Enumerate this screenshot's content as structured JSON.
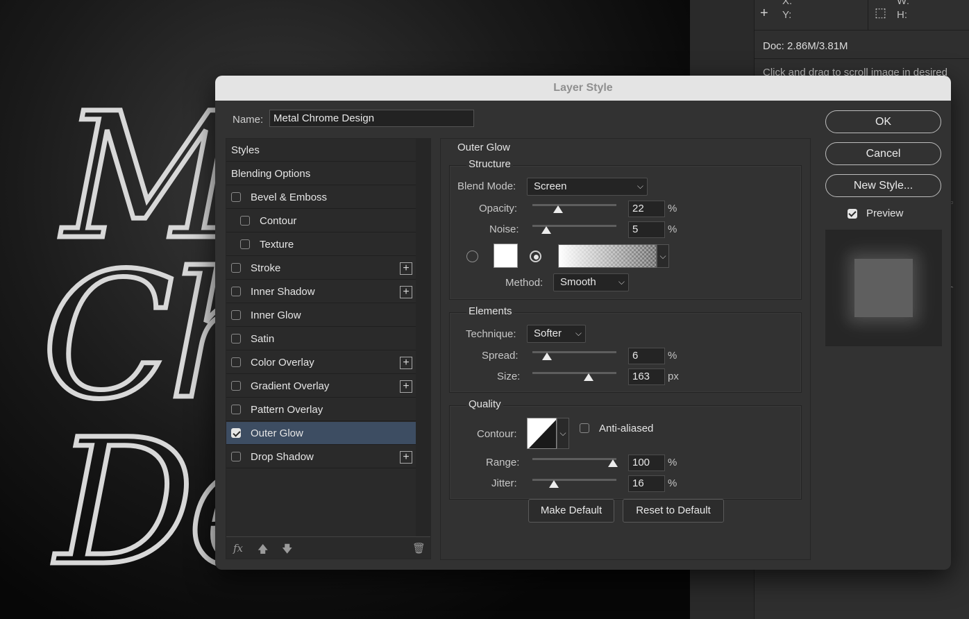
{
  "window": {
    "title": "Layer Style"
  },
  "info_panel": {
    "x_label": "X:",
    "y_label": "Y:",
    "w_label": "W:",
    "h_label": "H:",
    "doc_info": "Doc: 2.86M/3.81M",
    "hint": "Click and drag to scroll image in desired"
  },
  "canvas": {
    "lines": [
      "M",
      "Ch",
      "De"
    ]
  },
  "dialog": {
    "name_label": "Name:",
    "name_value": "Metal  Chrome Design",
    "styles_list": [
      {
        "label": "Styles",
        "checkbox": false,
        "checked": false,
        "plus": false,
        "selected": false,
        "indent": 0
      },
      {
        "label": "Blending Options",
        "checkbox": false,
        "checked": false,
        "plus": false,
        "selected": false,
        "indent": 0
      },
      {
        "label": "Bevel & Emboss",
        "checkbox": true,
        "checked": false,
        "plus": false,
        "selected": false,
        "indent": 0
      },
      {
        "label": "Contour",
        "checkbox": true,
        "checked": false,
        "plus": false,
        "selected": false,
        "indent": 1
      },
      {
        "label": "Texture",
        "checkbox": true,
        "checked": false,
        "plus": false,
        "selected": false,
        "indent": 1
      },
      {
        "label": "Stroke",
        "checkbox": true,
        "checked": false,
        "plus": true,
        "selected": false,
        "indent": 0
      },
      {
        "label": "Inner Shadow",
        "checkbox": true,
        "checked": false,
        "plus": true,
        "selected": false,
        "indent": 0
      },
      {
        "label": "Inner Glow",
        "checkbox": true,
        "checked": false,
        "plus": false,
        "selected": false,
        "indent": 0
      },
      {
        "label": "Satin",
        "checkbox": true,
        "checked": false,
        "plus": false,
        "selected": false,
        "indent": 0
      },
      {
        "label": "Color Overlay",
        "checkbox": true,
        "checked": false,
        "plus": true,
        "selected": false,
        "indent": 0
      },
      {
        "label": "Gradient Overlay",
        "checkbox": true,
        "checked": false,
        "plus": true,
        "selected": false,
        "indent": 0
      },
      {
        "label": "Pattern Overlay",
        "checkbox": true,
        "checked": false,
        "plus": false,
        "selected": false,
        "indent": 0
      },
      {
        "label": "Outer Glow",
        "checkbox": true,
        "checked": true,
        "plus": false,
        "selected": true,
        "indent": 0
      },
      {
        "label": "Drop Shadow",
        "checkbox": true,
        "checked": false,
        "plus": true,
        "selected": false,
        "indent": 0
      }
    ],
    "list_tools": {
      "fx": "fx",
      "up": "🡅",
      "down": "🡇",
      "trash": "🗑"
    },
    "outer_glow": {
      "section_title": "Outer Glow",
      "structure": {
        "title": "Structure",
        "blend_mode_label": "Blend Mode:",
        "blend_mode": "Screen",
        "opacity_label": "Opacity:",
        "opacity": "22",
        "noise_label": "Noise:",
        "noise": "5",
        "percent": "%",
        "fill_mode": "gradient",
        "swatch_color": "#ffffff",
        "method_label": "Method:",
        "method": "Smooth"
      },
      "elements": {
        "title": "Elements",
        "technique_label": "Technique:",
        "technique": "Softer",
        "spread_label": "Spread:",
        "spread": "6",
        "size_label": "Size:",
        "size": "163",
        "px": "px",
        "percent": "%"
      },
      "quality": {
        "title": "Quality",
        "contour_label": "Contour:",
        "anti_aliased_label": "Anti-aliased",
        "anti_aliased": false,
        "range_label": "Range:",
        "range": "100",
        "jitter_label": "Jitter:",
        "jitter": "16",
        "percent": "%"
      },
      "make_default": "Make Default",
      "reset_default": "Reset to Default"
    },
    "buttons": {
      "ok": "OK",
      "cancel": "Cancel",
      "new_style": "New Style..."
    },
    "preview_label": "Preview",
    "preview_checked": true
  },
  "slider_levels": {
    "opacity": 0.22,
    "noise": 0.05,
    "spread": 0.06,
    "size": 0.65,
    "range": 1.0,
    "jitter": 0.16
  }
}
